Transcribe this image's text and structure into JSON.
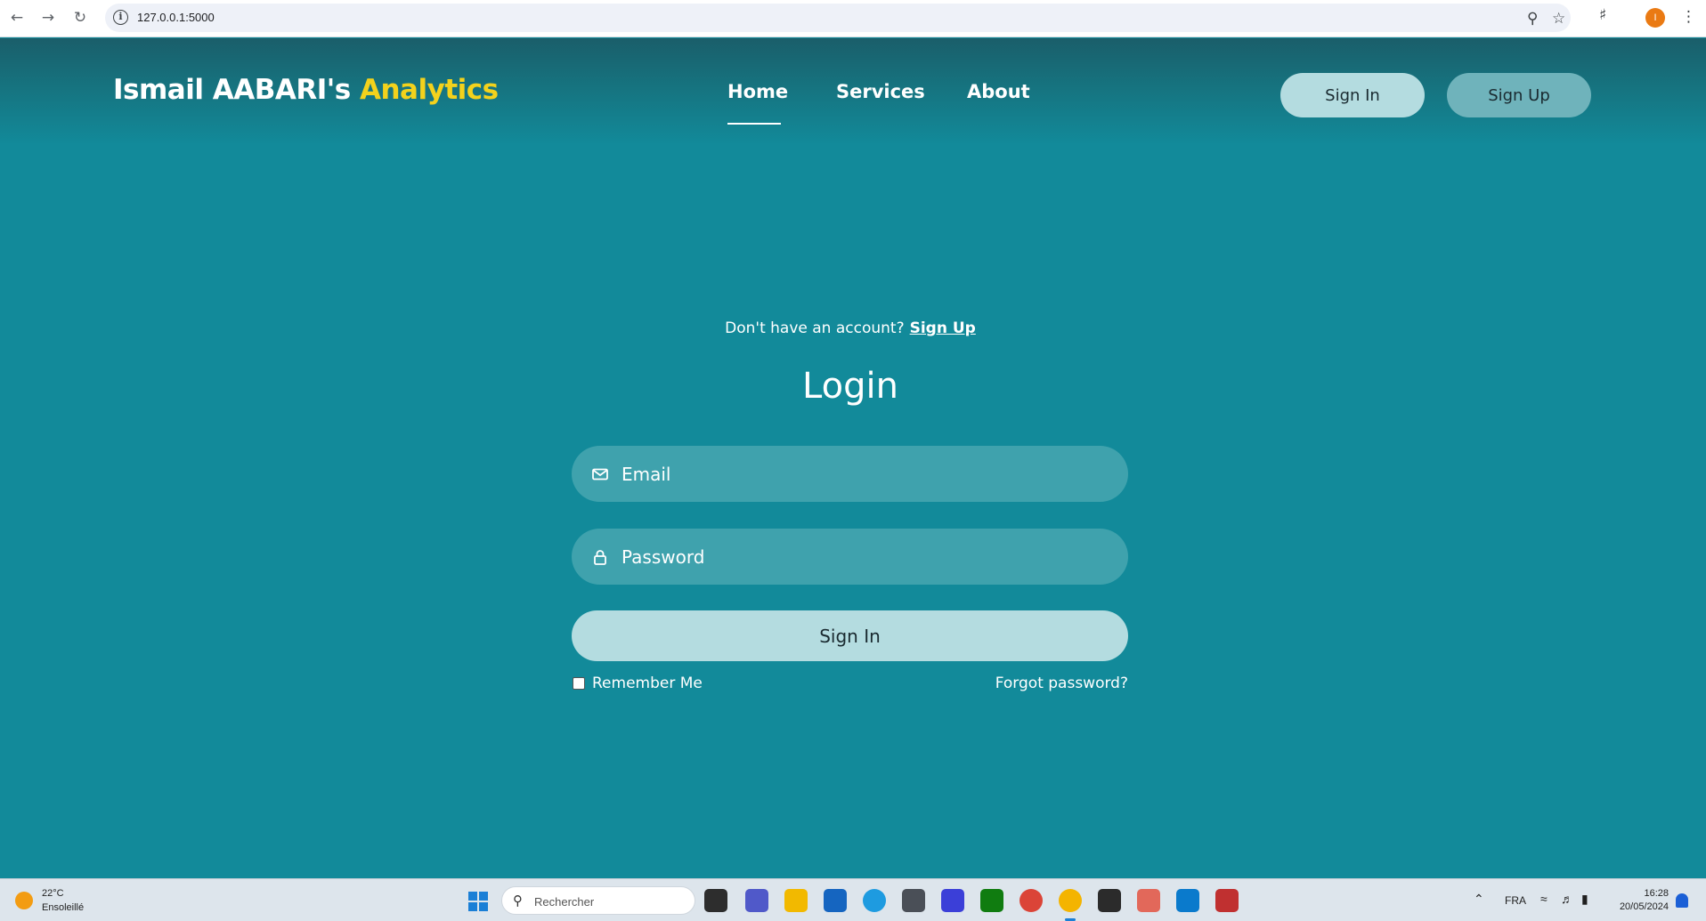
{
  "browser": {
    "url": "127.0.0.1:5000"
  },
  "header": {
    "brand_main": "Ismail AABARI's ",
    "brand_accent": "Analytics",
    "nav": [
      "Home",
      "Services",
      "About"
    ],
    "active_nav": "Home",
    "sign_in": "Sign In",
    "sign_up": "Sign Up"
  },
  "login": {
    "prompt": "Don't have an account?",
    "prompt_link": "Sign Up",
    "title": "Login",
    "email_placeholder": "Email",
    "password_placeholder": "Password",
    "submit": "Sign In",
    "remember": "Remember Me",
    "forgot": "Forgot password?"
  },
  "taskbar": {
    "temp": "22°C",
    "weather": "Ensoleillé",
    "search_placeholder": "Rechercher",
    "language": "FRA",
    "time": "16:28",
    "date": "20/05/2024"
  },
  "colors": {
    "background": "#128a9a",
    "accent": "#f3d21c",
    "button_light": "#b4dce0",
    "button_mid": "#6fb3bb",
    "field": "#3fa2ad"
  }
}
